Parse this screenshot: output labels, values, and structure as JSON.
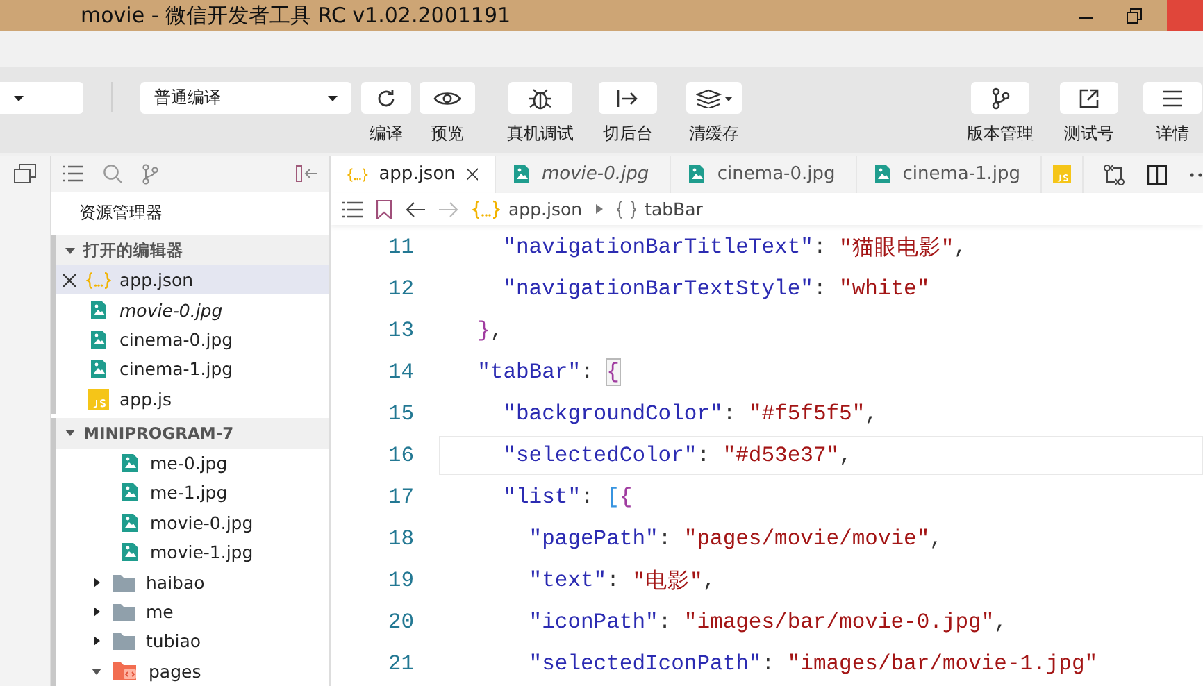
{
  "window": {
    "title": "movie - 微信开发者工具 RC v1.02.2001191"
  },
  "toolbar": {
    "compile_dropdown": {
      "value": "普通编译"
    },
    "tools": [
      {
        "kind": "refresh",
        "label": "编译"
      },
      {
        "kind": "eye",
        "label": "预览"
      },
      {
        "kind": "bug",
        "label": "真机调试"
      },
      {
        "kind": "switch",
        "label": "切后台"
      },
      {
        "kind": "layers",
        "label": "清缓存"
      },
      {
        "kind": "branch",
        "label": "版本管理"
      },
      {
        "kind": "share",
        "label": "测试号"
      },
      {
        "kind": "menu",
        "label": "详情"
      }
    ]
  },
  "sidebar": {
    "title": "资源管理器",
    "open_editors": {
      "title": "打开的编辑器",
      "expanded": true,
      "items": [
        {
          "name": "app.json",
          "kind": "json",
          "selected": true,
          "preview": false
        },
        {
          "name": "movie-0.jpg",
          "kind": "image",
          "selected": false,
          "preview": true
        },
        {
          "name": "cinema-0.jpg",
          "kind": "image",
          "selected": false,
          "preview": false
        },
        {
          "name": "cinema-1.jpg",
          "kind": "image",
          "selected": false,
          "preview": false
        },
        {
          "name": "app.js",
          "kind": "js",
          "selected": false,
          "preview": false
        }
      ]
    },
    "project": {
      "title": "MINIPROGRAM-7",
      "expanded": true,
      "files": [
        {
          "name": "me-0.jpg",
          "kind": "image"
        },
        {
          "name": "me-1.jpg",
          "kind": "image"
        },
        {
          "name": "movie-0.jpg",
          "kind": "image"
        },
        {
          "name": "movie-1.jpg",
          "kind": "image"
        }
      ],
      "folders": [
        {
          "name": "haibao",
          "kind": "folder",
          "expanded": false
        },
        {
          "name": "me",
          "kind": "folder",
          "expanded": false
        },
        {
          "name": "tubiao",
          "kind": "folder",
          "expanded": false
        },
        {
          "name": "pages",
          "kind": "pages-folder",
          "expanded": true
        }
      ]
    }
  },
  "editor": {
    "tabs": [
      {
        "label": "app.json",
        "kind": "json",
        "selected": true,
        "preview": false
      },
      {
        "label": "movie-0.jpg",
        "kind": "image",
        "selected": false,
        "preview": true
      },
      {
        "label": "cinema-0.jpg",
        "kind": "image",
        "selected": false,
        "preview": false
      },
      {
        "label": "cinema-1.jpg",
        "kind": "image",
        "selected": false,
        "preview": false
      },
      {
        "kind": "js",
        "selected": false
      }
    ],
    "breadcrumb": [
      {
        "label": "app.json",
        "kind": "json"
      },
      {
        "label": "tabBar",
        "kind": "object"
      }
    ],
    "code": [
      {
        "children": [
          {
            "children": [
              {
                "number": "11",
                "current": false,
                "tokens": [
                  {
                    "kind": "key",
                    "text": "\"navigationBarTitleText\""
                  },
                  {
                    "kind": "punct",
                    "text": ": "
                  },
                  {
                    "kind": "string",
                    "text": "\"猫眼电影\""
                  },
                  {
                    "kind": "punct",
                    "text": ","
                  }
                ]
              },
              {
                "number": "12",
                "current": false,
                "tokens": [
                  {
                    "kind": "key",
                    "text": "\"navigationBarTextStyle\""
                  },
                  {
                    "kind": "punct",
                    "text": ": "
                  },
                  {
                    "kind": "string",
                    "text": "\"white\""
                  }
                ]
              }
            ]
          },
          {
            "number": "13",
            "current": false,
            "tokens": [
              {
                "kind": "brace",
                "text": "}"
              },
              {
                "kind": "punct",
                "text": ","
              }
            ]
          },
          {
            "number": "14",
            "current": false,
            "tokens": [
              {
                "kind": "key",
                "text": "\"tabBar\""
              },
              {
                "kind": "punct",
                "text": ": "
              },
              {
                "kind": "brace",
                "text": "{",
                "matched": true
              }
            ]
          },
          {
            "children": [
              {
                "number": "15",
                "current": false,
                "tokens": [
                  {
                    "kind": "key",
                    "text": "\"backgroundColor\""
                  },
                  {
                    "kind": "punct",
                    "text": ": "
                  },
                  {
                    "kind": "string",
                    "text": "\"#f5f5f5\""
                  },
                  {
                    "kind": "punct",
                    "text": ","
                  }
                ]
              },
              {
                "number": "16",
                "current": true,
                "tokens": [
                  {
                    "kind": "key",
                    "text": "\"selectedColor\""
                  },
                  {
                    "kind": "punct",
                    "text": ": "
                  },
                  {
                    "kind": "string",
                    "text": "\"#d53e37\""
                  },
                  {
                    "kind": "punct",
                    "text": ","
                  }
                ]
              },
              {
                "number": "17",
                "current": false,
                "tokens": [
                  {
                    "kind": "key",
                    "text": "\"list\""
                  },
                  {
                    "kind": "punct",
                    "text": ": "
                  },
                  {
                    "kind": "bracket",
                    "text": "["
                  },
                  {
                    "kind": "brace",
                    "text": "{"
                  }
                ]
              },
              {
                "children": [
                  {
                    "number": "18",
                    "current": false,
                    "tokens": [
                      {
                        "kind": "key",
                        "text": "\"pagePath\""
                      },
                      {
                        "kind": "punct",
                        "text": ": "
                      },
                      {
                        "kind": "string",
                        "text": "\"pages/movie/movie\""
                      },
                      {
                        "kind": "punct",
                        "text": ","
                      }
                    ]
                  },
                  {
                    "number": "19",
                    "current": false,
                    "tokens": [
                      {
                        "kind": "key",
                        "text": "\"text\""
                      },
                      {
                        "kind": "punct",
                        "text": ": "
                      },
                      {
                        "kind": "string",
                        "text": "\"电影\""
                      },
                      {
                        "kind": "punct",
                        "text": ","
                      }
                    ]
                  },
                  {
                    "number": "20",
                    "current": false,
                    "tokens": [
                      {
                        "kind": "key",
                        "text": "\"iconPath\""
                      },
                      {
                        "kind": "punct",
                        "text": ": "
                      },
                      {
                        "kind": "string",
                        "text": "\"images/bar/movie-0.jpg\""
                      },
                      {
                        "kind": "punct",
                        "text": ","
                      }
                    ]
                  },
                  {
                    "number": "21",
                    "current": false,
                    "tokens": [
                      {
                        "kind": "key",
                        "text": "\"selectedIconPath\""
                      },
                      {
                        "kind": "punct",
                        "text": ": "
                      },
                      {
                        "kind": "string",
                        "text": "\"images/bar/movie-1.jpg\""
                      }
                    ]
                  }
                ]
              }
            ]
          }
        ]
      }
    ]
  }
}
